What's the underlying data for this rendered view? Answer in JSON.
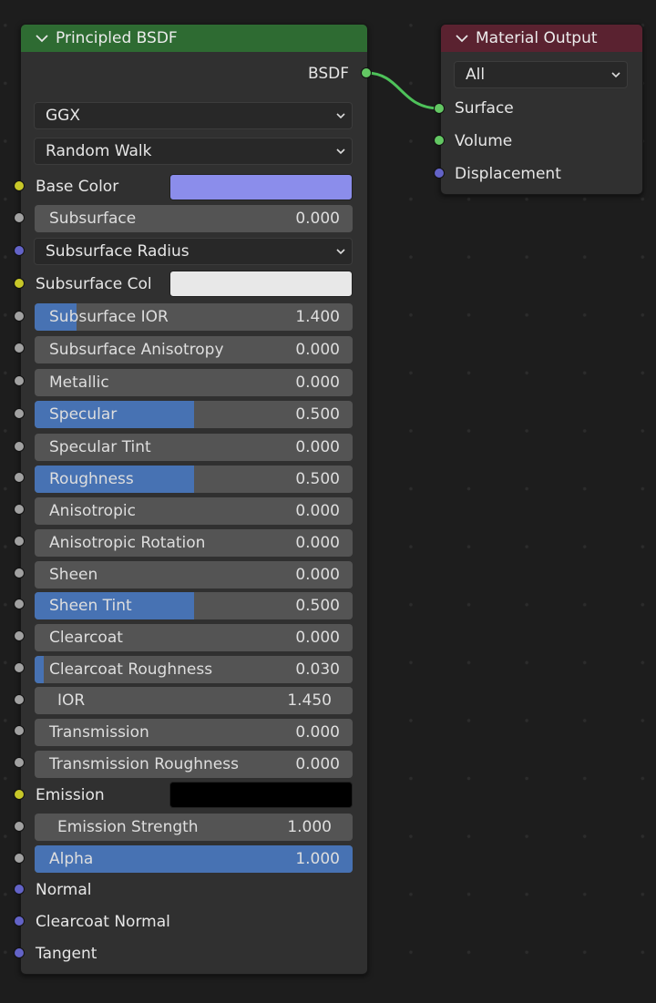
{
  "colors": {
    "bsdf_header": "#2e6b32",
    "output_header": "#5a2230",
    "slider_fill": "#4772b3",
    "base_color": "#8b8deb",
    "subsurface_color": "#e8e8e8",
    "emission_color": "#000000",
    "link": "#4ec25a"
  },
  "bsdf_node": {
    "title": "Principled BSDF",
    "output_socket": "BSDF",
    "distribution": "GGX",
    "subsurface_method": "Random Walk",
    "base_color_label": "Base Color",
    "subsurface_radius_label": "Subsurface Radius",
    "subsurface_color_label": "Subsurface Col",
    "emission_label": "Emission",
    "normal_label": "Normal",
    "clearcoat_normal_label": "Clearcoat Normal",
    "tangent_label": "Tangent",
    "fields": [
      {
        "label": "Subsurface",
        "value": "0.000",
        "fill": 0
      },
      {
        "label": "Subsurface IOR",
        "value": "1.400",
        "fill": 0.133
      },
      {
        "label": "Subsurface Anisotropy",
        "value": "0.000",
        "fill": 0
      },
      {
        "label": "Metallic",
        "value": "0.000",
        "fill": 0
      },
      {
        "label": "Specular",
        "value": "0.500",
        "fill": 0.5
      },
      {
        "label": "Specular Tint",
        "value": "0.000",
        "fill": 0
      },
      {
        "label": "Roughness",
        "value": "0.500",
        "fill": 0.5
      },
      {
        "label": "Anisotropic",
        "value": "0.000",
        "fill": 0
      },
      {
        "label": "Anisotropic Rotation",
        "value": "0.000",
        "fill": 0
      },
      {
        "label": "Sheen",
        "value": "0.000",
        "fill": 0
      },
      {
        "label": "Sheen Tint",
        "value": "0.500",
        "fill": 0.5
      },
      {
        "label": "Clearcoat",
        "value": "0.000",
        "fill": 0
      },
      {
        "label": "Clearcoat Roughness",
        "value": "0.030",
        "fill": 0.03
      },
      {
        "label": "IOR",
        "value": "1.450",
        "fill": 0
      },
      {
        "label": "Transmission",
        "value": "0.000",
        "fill": 0
      },
      {
        "label": "Transmission Roughness",
        "value": "0.000",
        "fill": 0
      },
      {
        "label": "Emission Strength",
        "value": "1.000",
        "fill": 0
      },
      {
        "label": "Alpha",
        "value": "1.000",
        "fill": 1
      }
    ]
  },
  "output_node": {
    "title": "Material Output",
    "target": "All",
    "sockets": [
      "Surface",
      "Volume",
      "Displacement"
    ]
  }
}
